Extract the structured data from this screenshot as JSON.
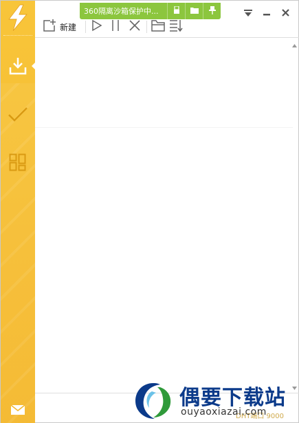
{
  "colors": {
    "sidebar": "#f4b72a",
    "sandbox": "#8cc63e",
    "toolbar_icon": "#666666",
    "port_text": "#d0a94b",
    "watermark": "#0b3a8a"
  },
  "sidebar": {
    "logo_icon": "lightning-bolt-icon",
    "items": [
      {
        "icon": "download-icon",
        "active": true
      },
      {
        "icon": "check-icon",
        "active": false
      },
      {
        "icon": "app-grid-icon",
        "active": false
      }
    ],
    "mail_icon": "mail-icon"
  },
  "sandbox": {
    "text": "360隔离沙箱保护中...",
    "buttons": [
      "usb-icon",
      "folder-icon",
      "pin-icon"
    ]
  },
  "window_controls": [
    "dropdown-icon",
    "minimize-icon",
    "close-icon"
  ],
  "toolbar": {
    "new_label": "新建",
    "buttons": [
      "new-task-icon",
      "start-icon",
      "pause-icon",
      "delete-icon",
      "open-folder-icon",
      "sort-icon"
    ]
  },
  "status": {
    "port_text": "DHT端口 9000"
  },
  "watermark": {
    "title": "偶要下载站",
    "url": "ouyaoxiazai.com"
  }
}
